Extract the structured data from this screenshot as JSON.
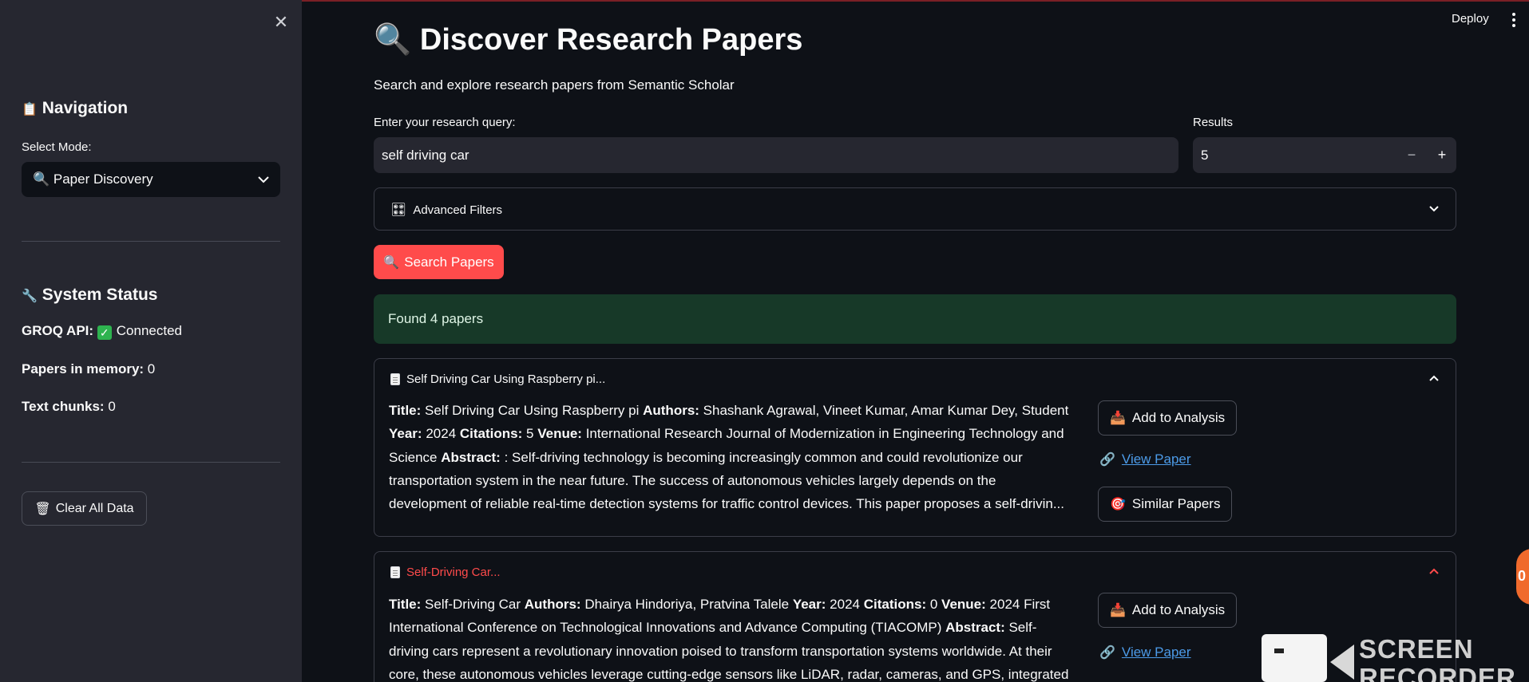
{
  "sidebar": {
    "navigation_title": "Navigation",
    "navigation_emoji": "📋",
    "select_label": "Select Mode:",
    "select_value": "🔍 Paper Discovery",
    "status_title": "System Status",
    "status_emoji": "🔧",
    "groq_label": "GROQ API:",
    "groq_value": "Connected",
    "papers_label": "Papers in memory:",
    "papers_value": "0",
    "chunks_label": "Text chunks:",
    "chunks_value": "0",
    "clear_button": "Clear All Data",
    "clear_emoji": "🗑"
  },
  "header": {
    "deploy": "Deploy",
    "title": "Discover Research Papers",
    "title_emoji": "🔍",
    "subtitle": "Search and explore research papers from Semantic Scholar"
  },
  "search": {
    "query_label": "Enter your research query:",
    "query_value": "self driving car",
    "results_label": "Results",
    "results_value": "5",
    "minus": "−",
    "plus": "+",
    "filters_label": "Advanced Filters",
    "filters_emoji": "🎛",
    "search_button": "Search Papers",
    "search_emoji": "🔍"
  },
  "success_message": "Found 4 papers",
  "papers": [
    {
      "header": "Self Driving Car Using Raspberry pi...",
      "title_label": "Title:",
      "title": "Self Driving Car Using Raspberry pi",
      "authors_label": "Authors:",
      "authors": "Shashank Agrawal, Vineet Kumar, Amar Kumar Dey, Student",
      "year_label": "Year:",
      "year": "2024",
      "citations_label": "Citations:",
      "citations": "5",
      "venue_label": "Venue:",
      "venue": "International Research Journal of Modernization in Engineering Technology and Science",
      "abstract_label": "Abstract:",
      "abstract": ": Self-driving technology is becoming increasingly common and could revolutionize our transportation system in the near future. The success of autonomous vehicles largely depends on the development of reliable real-time detection systems for traffic control devices. This paper proposes a self-drivin..."
    },
    {
      "header": "Self-Driving Car...",
      "title_label": "Title:",
      "title": "Self-Driving Car",
      "authors_label": "Authors:",
      "authors": "Dhairya Hindoriya, Pratvina Talele",
      "year_label": "Year:",
      "year": "2024",
      "citations_label": "Citations:",
      "citations": "0",
      "venue_label": "Venue:",
      "venue": "2024 First International Conference on Technological Innovations and Advance Computing (TIACOMP)",
      "abstract_label": "Abstract:",
      "abstract": "Self-driving cars represent a revolutionary innovation poised to transform transportation systems worldwide. At their core, these autonomous vehicles leverage cutting-edge sensors like LiDAR, radar, cameras, and GPS, integrated with"
    }
  ],
  "actions": {
    "add_label": "Add to Analysis",
    "add_emoji": "📥",
    "view_label": "View Paper",
    "view_emoji": "🔗",
    "similar_label": "Similar Papers",
    "similar_emoji": "🎯"
  },
  "overlay": {
    "recorder_text": "SCREEN RECORDER",
    "badge": "0"
  },
  "colors": {
    "accent": "#ff4b4b",
    "background": "#0e1117",
    "sidebar": "#262730",
    "success": "#173928",
    "link": "#4c9be8"
  }
}
